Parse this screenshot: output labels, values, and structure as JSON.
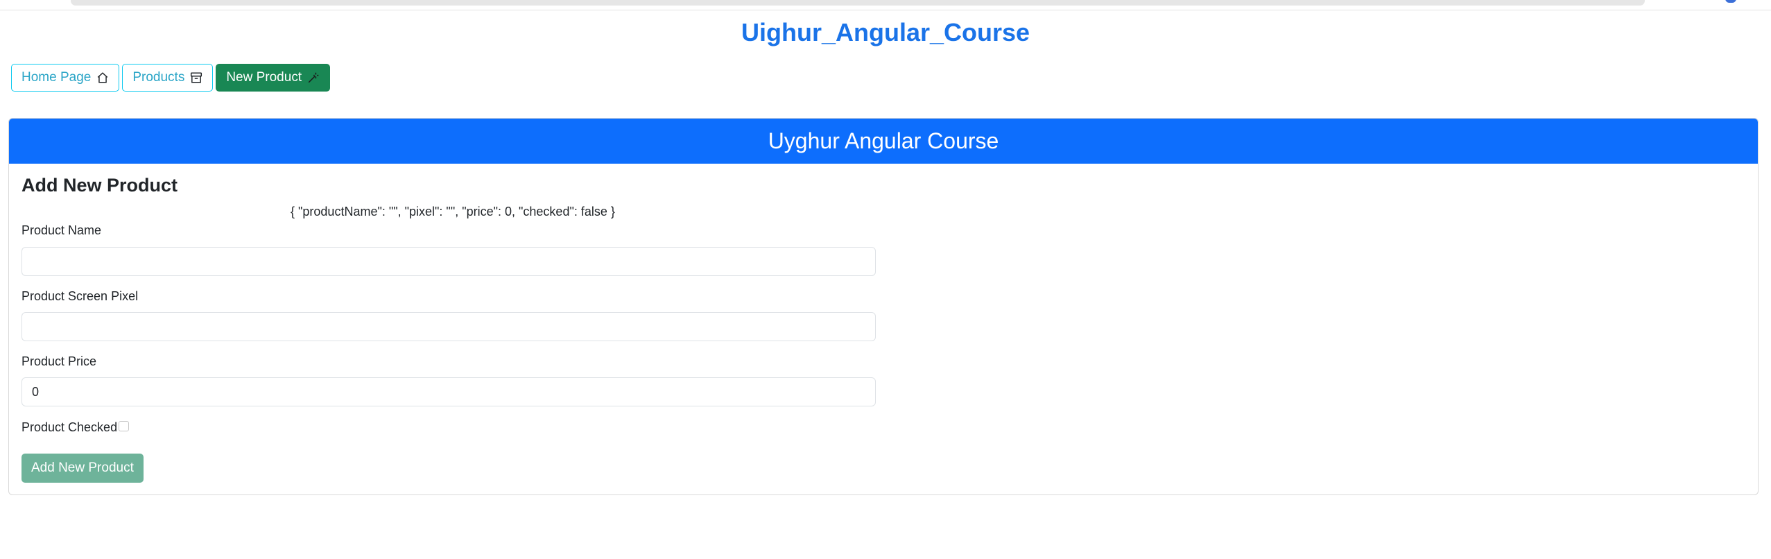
{
  "app": {
    "title": "Uighur_Angular_Course"
  },
  "nav": {
    "items": [
      {
        "label": "Home Page",
        "icon": "house-icon",
        "active": false
      },
      {
        "label": "Products",
        "icon": "archive-icon",
        "active": false
      },
      {
        "label": "New Product",
        "icon": "magic-wand-icon",
        "active": true
      }
    ]
  },
  "card": {
    "header": "Uyghur Angular Course",
    "form_title": "Add New Product",
    "debug_json": "{ \"productName\": \"\", \"pixel\": \"\", \"price\": 0, \"checked\": false }",
    "fields": {
      "name": {
        "label": "Product Name",
        "value": ""
      },
      "pixel": {
        "label": "Product Screen Pixel",
        "value": ""
      },
      "price": {
        "label": "Product Price",
        "value": "0"
      },
      "checked": {
        "label": "Product Checked",
        "value": false
      }
    },
    "submit_label": "Add New Product"
  },
  "colors": {
    "title": "#1a73e8",
    "header_bg": "#0d6efd",
    "nav_outline": "#0dcaf0",
    "nav_active": "#198754",
    "submit_disabled": "#6eb39a"
  }
}
